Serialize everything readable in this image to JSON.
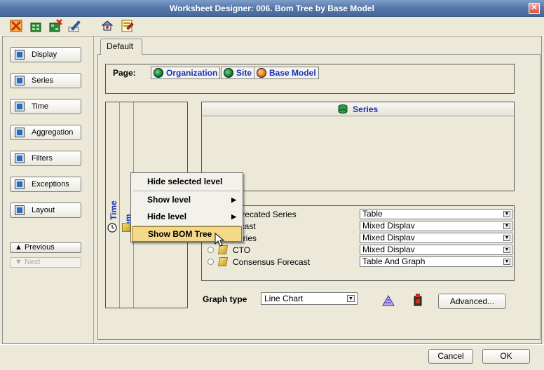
{
  "window": {
    "title": "Worksheet Designer: 006. Bom Tree by Base Model",
    "close_glyph": "✕"
  },
  "toolbar": {
    "icons": [
      "delete-icon",
      "add-series-icon",
      "remove-series-icon",
      "edit-icon",
      "wizard-icon",
      "properties-icon"
    ]
  },
  "nav": {
    "items": [
      {
        "label": "Display",
        "icon": "display-icon"
      },
      {
        "label": "Series",
        "icon": "series-icon"
      },
      {
        "label": "Time",
        "icon": "time-icon"
      },
      {
        "label": "Aggregation",
        "icon": "aggregation-icon"
      },
      {
        "label": "Filters",
        "icon": "filters-icon"
      },
      {
        "label": "Exceptions",
        "icon": "exceptions-icon"
      },
      {
        "label": "Layout",
        "icon": "layout-icon"
      }
    ],
    "previous": "Previous",
    "next": "Next"
  },
  "tabs": [
    {
      "label": "Default"
    }
  ],
  "page": {
    "label": "Page:",
    "levels": [
      "Organization",
      "Site",
      "Base Model"
    ]
  },
  "axes": {
    "time": "Time",
    "item": "Item"
  },
  "series_header": "Series",
  "context_menu": {
    "items": [
      {
        "label": "Hide selected level",
        "submenu": false
      },
      {
        "label": "Show level",
        "submenu": true
      },
      {
        "label": "Hide level",
        "submenu": true
      },
      {
        "label": "Show BOM Tree",
        "submenu": false,
        "highlighted": true
      }
    ]
  },
  "series_rows": [
    {
      "name": "eprecated Series",
      "display": "Table"
    },
    {
      "name": "recast",
      "display": "Mixed Displav"
    },
    {
      "name": "Series",
      "display": "Mixed Displav"
    },
    {
      "name": "CTO",
      "display": "Mixed Displav"
    },
    {
      "name": "Consensus Forecast",
      "display": "Table And Graph"
    }
  ],
  "graph": {
    "label": "Graph type",
    "value": "Line Chart",
    "advanced": "Advanced..."
  },
  "footer": {
    "cancel": "Cancel",
    "ok": "OK"
  }
}
